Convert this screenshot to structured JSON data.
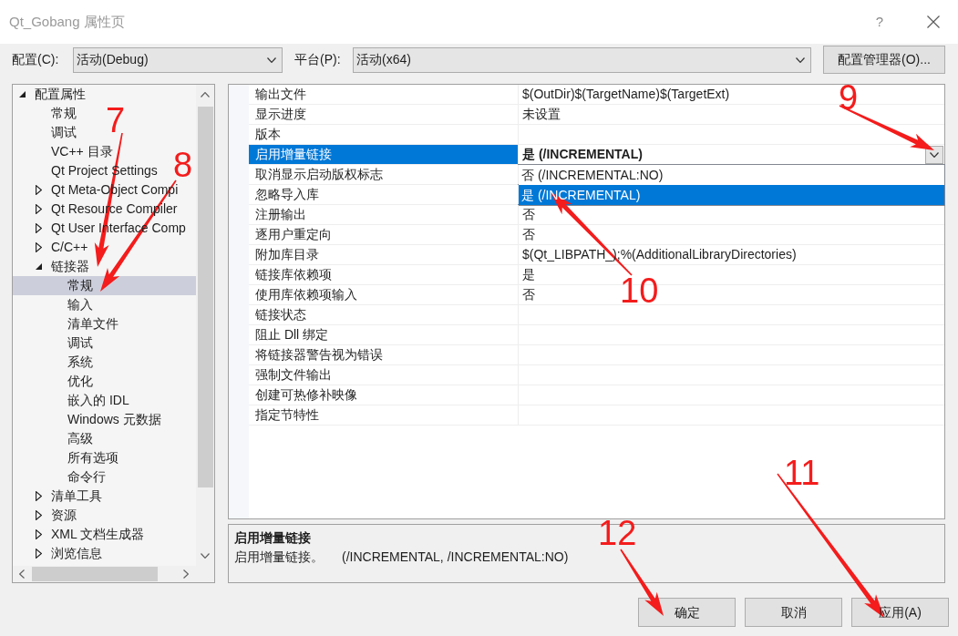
{
  "window": {
    "title": "Qt_Gobang 属性页",
    "help": "?"
  },
  "config_bar": {
    "configuration": {
      "label": "配置(C):",
      "value": "活动(Debug)"
    },
    "platform": {
      "label": "平台(P):",
      "value": "活动(x64)"
    },
    "manager_button": "配置管理器(O)..."
  },
  "tree": {
    "items": [
      {
        "label": "配置属性",
        "expanded": true,
        "selected": false,
        "children": [
          {
            "label": "常规",
            "selected": false
          },
          {
            "label": "调试",
            "selected": false
          },
          {
            "label": "VC++ 目录",
            "selected": false
          },
          {
            "label": "Qt Project Settings",
            "selected": false
          },
          {
            "label": "Qt Meta-Object Compi",
            "expanded": false,
            "selected": false
          },
          {
            "label": "Qt Resource Compiler",
            "expanded": false,
            "selected": false
          },
          {
            "label": "Qt User Interface Comp",
            "expanded": false,
            "selected": false
          },
          {
            "label": "C/C++",
            "expanded": false,
            "selected": false
          },
          {
            "label": "链接器",
            "expanded": true,
            "selected": false,
            "children": [
              {
                "label": "常规",
                "selected": true
              },
              {
                "label": "输入",
                "selected": false
              },
              {
                "label": "清单文件",
                "selected": false
              },
              {
                "label": "调试",
                "selected": false
              },
              {
                "label": "系统",
                "selected": false
              },
              {
                "label": "优化",
                "selected": false
              },
              {
                "label": "嵌入的 IDL",
                "selected": false
              },
              {
                "label": "Windows 元数据",
                "selected": false
              },
              {
                "label": "高级",
                "selected": false
              },
              {
                "label": "所有选项",
                "selected": false
              },
              {
                "label": "命令行",
                "selected": false
              }
            ]
          },
          {
            "label": "清单工具",
            "expanded": false,
            "selected": false
          },
          {
            "label": "资源",
            "expanded": false,
            "selected": false
          },
          {
            "label": "XML 文档生成器",
            "expanded": false,
            "selected": false
          },
          {
            "label": "浏览信息",
            "expanded": false,
            "selected": false
          }
        ]
      }
    ]
  },
  "property_grid": {
    "rows": [
      {
        "name": "输出文件",
        "value": "$(OutDir)$(TargetName)$(TargetExt)",
        "modified": false,
        "selected": false
      },
      {
        "name": "显示进度",
        "value": "未设置",
        "modified": false,
        "selected": false
      },
      {
        "name": "版本",
        "selected": false
      },
      {
        "name": "启用增量链接",
        "value": "是 (/INCREMENTAL)",
        "modified": true,
        "selected": true,
        "dropdown": {
          "expanded": true,
          "options": [
            {
              "label": "否 (/INCREMENTAL:NO)",
              "selected": false
            },
            {
              "label": "是 (/INCREMENTAL)",
              "selected": true
            }
          ]
        }
      },
      {
        "name": "取消显示启动版权标志",
        "selected": false
      },
      {
        "name": "忽略导入库",
        "selected": false
      },
      {
        "name": "注册输出",
        "value": "否",
        "modified": false,
        "selected": false
      },
      {
        "name": "逐用户重定向",
        "value": "否",
        "modified": false,
        "selected": false
      },
      {
        "name": "附加库目录",
        "value": "$(Qt_LIBPATH_);%(AdditionalLibraryDirectories)",
        "modified": false,
        "selected": false
      },
      {
        "name": "链接库依赖项",
        "value": "是",
        "modified": false,
        "selected": false
      },
      {
        "name": "使用库依赖项输入",
        "value": "否",
        "modified": false,
        "selected": false
      },
      {
        "name": "链接状态",
        "selected": false
      },
      {
        "name": "阻止 Dll 绑定",
        "selected": false
      },
      {
        "name": "将链接器警告视为错误",
        "selected": false
      },
      {
        "name": "强制文件输出",
        "selected": false
      },
      {
        "name": "创建可热修补映像",
        "selected": false
      },
      {
        "name": "指定节特性",
        "selected": false
      }
    ]
  },
  "description": {
    "title": "启用增量链接",
    "text": "启用增量链接。",
    "switches": "(/INCREMENTAL, /INCREMENTAL:NO)"
  },
  "buttons": [
    "确定",
    "取消",
    "应用(A)"
  ],
  "annotations": [
    {
      "label": "7"
    },
    {
      "label": "8"
    },
    {
      "label": "9"
    },
    {
      "label": "10"
    },
    {
      "label": "11"
    },
    {
      "label": "12"
    }
  ]
}
